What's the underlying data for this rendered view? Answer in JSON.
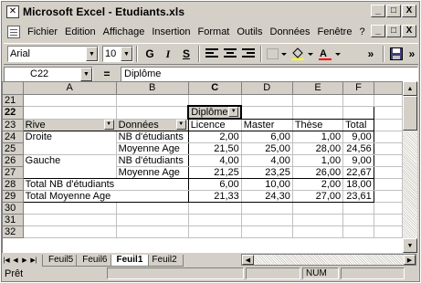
{
  "window": {
    "title": "Microsoft Excel - Etudiants.xls",
    "buttons": [
      "_",
      "□",
      "X"
    ]
  },
  "menu": {
    "items": [
      "Fichier",
      "Edition",
      "Affichage",
      "Insertion",
      "Format",
      "Outils",
      "Données",
      "Fenêtre",
      "?"
    ],
    "buttons": [
      "_",
      "□",
      "X"
    ]
  },
  "toolbar": {
    "font": "Arial",
    "size": "10",
    "bold": "G",
    "italic": "I",
    "underline": "S",
    "more": "»"
  },
  "formula": {
    "cell": "C22",
    "eq": "=",
    "content": "Diplôme"
  },
  "columns": [
    "",
    "A",
    "B",
    "C",
    "D",
    "E",
    "F"
  ],
  "rows": [
    {
      "n": "21",
      "cells": [
        "",
        "",
        "",
        "",
        "",
        ""
      ]
    },
    {
      "n": "22",
      "cells": [
        "",
        "",
        "Diplôme",
        "",
        "",
        ""
      ]
    },
    {
      "n": "23",
      "cells": [
        "Rive",
        "Données",
        "Licence",
        "Master",
        "Thèse",
        "Total"
      ]
    },
    {
      "n": "24",
      "cells": [
        "Droite",
        "NB d'étudiants",
        "2,00",
        "6,00",
        "1,00",
        "9,00"
      ]
    },
    {
      "n": "25",
      "cells": [
        "",
        "Moyenne Age",
        "21,50",
        "25,00",
        "28,00",
        "24,56"
      ]
    },
    {
      "n": "26",
      "cells": [
        "Gauche",
        "NB d'étudiants",
        "4,00",
        "4,00",
        "1,00",
        "9,00"
      ]
    },
    {
      "n": "27",
      "cells": [
        "",
        "Moyenne Age",
        "21,25",
        "23,25",
        "26,00",
        "22,67"
      ]
    },
    {
      "n": "28",
      "cells": [
        "Total NB d'étudiants",
        "",
        "6,00",
        "10,00",
        "2,00",
        "18,00"
      ]
    },
    {
      "n": "29",
      "cells": [
        "Total Moyenne Age",
        "",
        "21,33",
        "24,30",
        "27,00",
        "23,61"
      ]
    },
    {
      "n": "30",
      "cells": [
        "",
        "",
        "",
        "",
        "",
        ""
      ]
    },
    {
      "n": "31",
      "cells": [
        "",
        "",
        "",
        "",
        "",
        ""
      ]
    },
    {
      "n": "32",
      "cells": [
        "",
        "",
        "",
        "",
        "",
        ""
      ]
    }
  ],
  "tabs": [
    "Feuil5",
    "Feuil6",
    "Feuil1",
    "Feuil2"
  ],
  "active_tab": "Feuil1",
  "status": {
    "left": "Prêt",
    "num": "NUM"
  }
}
